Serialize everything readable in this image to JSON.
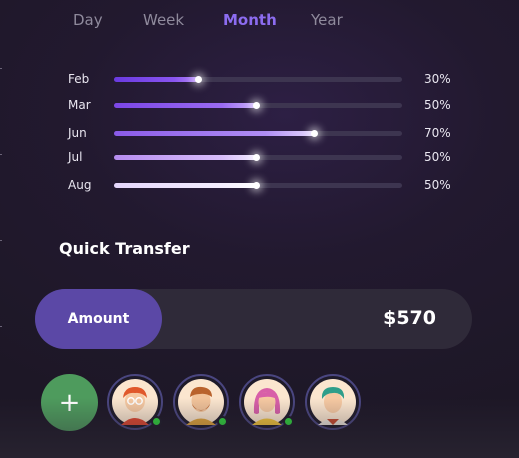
{
  "tabs": [
    {
      "label": "Day",
      "active": false
    },
    {
      "label": "Week",
      "active": false
    },
    {
      "label": "Month",
      "active": true
    },
    {
      "label": "Year",
      "active": false
    }
  ],
  "progress": [
    {
      "month": "Feb",
      "percent_label": "30%",
      "value": 0.3
    },
    {
      "month": "Mar",
      "percent_label": "50%",
      "value": 0.5
    },
    {
      "month": "Jun",
      "percent_label": "70%",
      "value": 0.7
    },
    {
      "month": "Jul",
      "percent_label": "50%",
      "value": 0.5
    },
    {
      "month": "Aug",
      "percent_label": "50%",
      "value": 0.5
    }
  ],
  "quick_transfer": {
    "title": "Quick Transfer",
    "amount_label": "Amount",
    "amount_value": "$570"
  },
  "contacts": {
    "add_icon": "plus-icon",
    "people": [
      {
        "name": "contact-1",
        "online": true
      },
      {
        "name": "contact-2",
        "online": true
      },
      {
        "name": "contact-3",
        "online": true
      },
      {
        "name": "contact-4",
        "online": false
      }
    ]
  },
  "colors": {
    "accent": "#8c6cf0",
    "amount_button": "#5b48a6",
    "add_button": "#4e9b5d",
    "online": "#2fd13c",
    "bar_track": "#3d3550"
  }
}
